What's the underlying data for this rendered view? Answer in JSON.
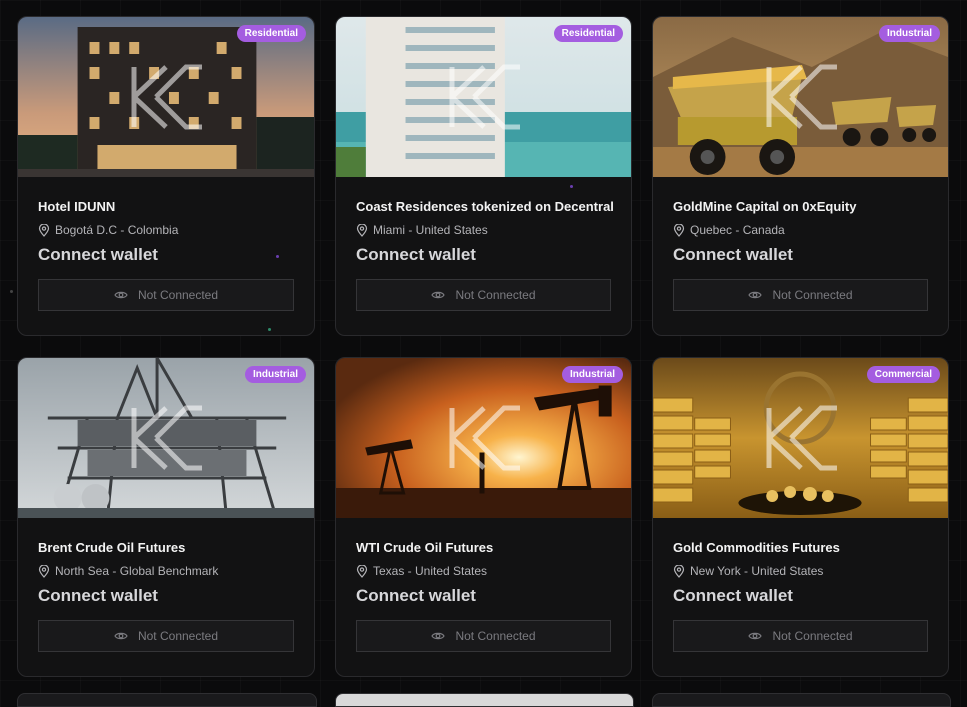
{
  "properties": [
    {
      "title": "Hotel IDUNN",
      "location": "Bogotá D.C - Colombia",
      "badge": "Residential",
      "cta": "Connect wallet",
      "status": "Not Connected",
      "image_icon": "hotel-building-image"
    },
    {
      "title": "Coast Residences tokenized on Decentral",
      "location": "Miami - United States",
      "badge": "Residential",
      "cta": "Connect wallet",
      "status": "Not Connected",
      "image_icon": "beach-tower-image"
    },
    {
      "title": "GoldMine Capital on 0xEquity",
      "location": "Quebec - Canada",
      "badge": "Industrial",
      "cta": "Connect wallet",
      "status": "Not Connected",
      "image_icon": "mining-trucks-image"
    },
    {
      "title": "Brent Crude Oil Futures",
      "location": "North Sea - Global Benchmark",
      "badge": "Industrial",
      "cta": "Connect wallet",
      "status": "Not Connected",
      "image_icon": "oil-platform-image"
    },
    {
      "title": "WTI Crude Oil Futures",
      "location": "Texas - United States",
      "badge": "Industrial",
      "cta": "Connect wallet",
      "status": "Not Connected",
      "image_icon": "oil-pumpjack-image"
    },
    {
      "title": "Gold Commodities Futures",
      "location": "New York - United States",
      "badge": "Commercial",
      "cta": "Connect wallet",
      "status": "Not Connected",
      "image_icon": "gold-vault-image"
    }
  ],
  "icons": {
    "location": "map-pin-icon",
    "status": "eye-icon",
    "logo": "ikz-logo-watermark"
  },
  "colors": {
    "badge": "#a45de0",
    "background": "#0b0b0c",
    "card": "#121213"
  }
}
